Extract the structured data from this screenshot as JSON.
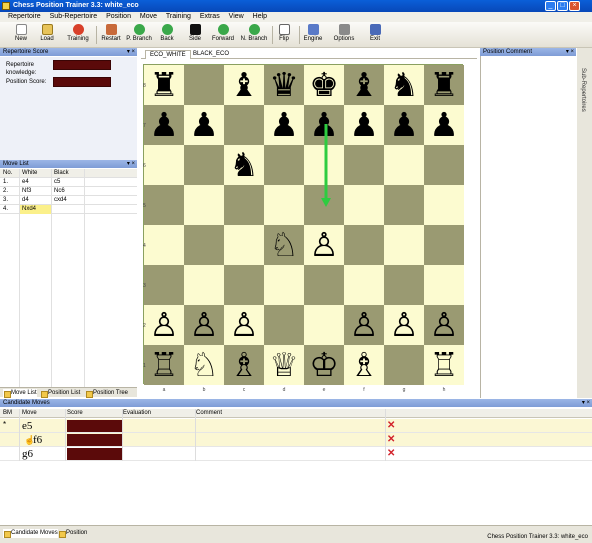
{
  "window": {
    "title": "Chess Position Trainer 3.3: white_eco"
  },
  "menu": [
    "Repertoire",
    "Sub-Repertoire",
    "Position",
    "Move",
    "Training",
    "Extras",
    "View",
    "Help"
  ],
  "toolbar": {
    "items": [
      {
        "label": "New",
        "icon": "new-file-icon"
      },
      {
        "label": "Load",
        "icon": "load-icon"
      },
      {
        "label": "Training",
        "icon": "training-icon"
      },
      {
        "label": "Restart",
        "icon": "home-icon"
      },
      {
        "label": "P. Branch",
        "icon": "prev-branch-icon"
      },
      {
        "label": "Back",
        "icon": "back-arrow-icon"
      },
      {
        "label": "Side",
        "icon": "side-icon"
      },
      {
        "label": "Forward",
        "icon": "forward-arrow-icon"
      },
      {
        "label": "N. Branch",
        "icon": "next-branch-icon"
      },
      {
        "label": "Flip",
        "icon": "flip-icon"
      },
      {
        "label": "Engine",
        "icon": "engine-icon"
      },
      {
        "label": "Options",
        "icon": "options-icon"
      },
      {
        "label": "Exit",
        "icon": "exit-icon"
      }
    ]
  },
  "repertoire_score": {
    "header": "Repertoire Score",
    "knowledge_label": "Repertoire knowledge:",
    "position_label": "Position Score:"
  },
  "move_list": {
    "header": "Move List",
    "columns": [
      "No.",
      "White",
      "Black"
    ],
    "rows": [
      {
        "no": "1.",
        "white": "e4",
        "black": "c5"
      },
      {
        "no": "2.",
        "white": "Nf3",
        "black": "Nc6"
      },
      {
        "no": "3.",
        "white": "d4",
        "black": "cxd4"
      },
      {
        "no": "4.",
        "white": "Nxd4",
        "black": ""
      }
    ]
  },
  "left_tabs": [
    "Move List",
    "Position List",
    "Position Tree"
  ],
  "board": {
    "tabs": [
      "ECO_WHITE",
      "BLACK_ECO"
    ],
    "files": [
      "a",
      "b",
      "c",
      "d",
      "e",
      "f",
      "g",
      "h"
    ],
    "ranks": [
      "8",
      "7",
      "6",
      "5",
      "4",
      "3",
      "2",
      "1"
    ],
    "squares": [
      "♜",
      "",
      "♝",
      "♛",
      "♚",
      "♝",
      "♞",
      "♜",
      "♟",
      "♟",
      "",
      "♟",
      "♟",
      "♟",
      "♟",
      "♟",
      "",
      "",
      "♞",
      "",
      "",
      "",
      "",
      "",
      "",
      "",
      "",
      "",
      "",
      "",
      "",
      "",
      "",
      "",
      "",
      "♘",
      "♙",
      "",
      "",
      "",
      "",
      "",
      "",
      "",
      "",
      "",
      "",
      "",
      "♙",
      "♙",
      "♙",
      "",
      "",
      "♙",
      "♙",
      "♙",
      "♖",
      "♘",
      "♗",
      "♕",
      "♔",
      "♗",
      "",
      "♖"
    ],
    "arrow": {
      "from": "e7",
      "to": "e5",
      "color": "#2ecc40"
    }
  },
  "position_comment": {
    "header": "Position Comment"
  },
  "side_strip": {
    "label": "Sub-Repertoires"
  },
  "candidates": {
    "header": "Candidate Moves",
    "columns": [
      "BM",
      "Move",
      "Score",
      "Evaluation",
      "Comment"
    ],
    "rows": [
      {
        "bm": "*",
        "move": "e5"
      },
      {
        "bm": "",
        "move": "f6"
      },
      {
        "bm": "",
        "move": "g6"
      }
    ]
  },
  "bottom_tabs": [
    "Candidate Moves",
    "Position"
  ],
  "status": "Chess Position Trainer 3.3: white_eco"
}
